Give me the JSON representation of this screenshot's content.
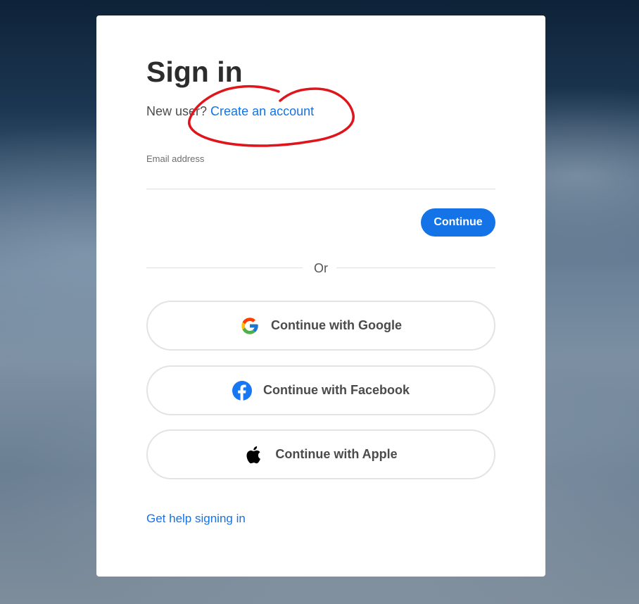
{
  "signin": {
    "title": "Sign in",
    "new_user_prefix": "New user? ",
    "create_account_label": "Create an account",
    "email": {
      "label": "Email address",
      "value": "",
      "placeholder": ""
    },
    "continue_label": "Continue",
    "divider_text": "Or",
    "social": {
      "google_label": "Continue with Google",
      "facebook_label": "Continue with Facebook",
      "apple_label": "Continue with Apple"
    },
    "help_label": "Get help signing in"
  },
  "colors": {
    "accent": "#1473e6",
    "annotation": "#e0151b"
  },
  "icons": {
    "google": "google-icon",
    "facebook": "facebook-icon",
    "apple": "apple-icon"
  }
}
